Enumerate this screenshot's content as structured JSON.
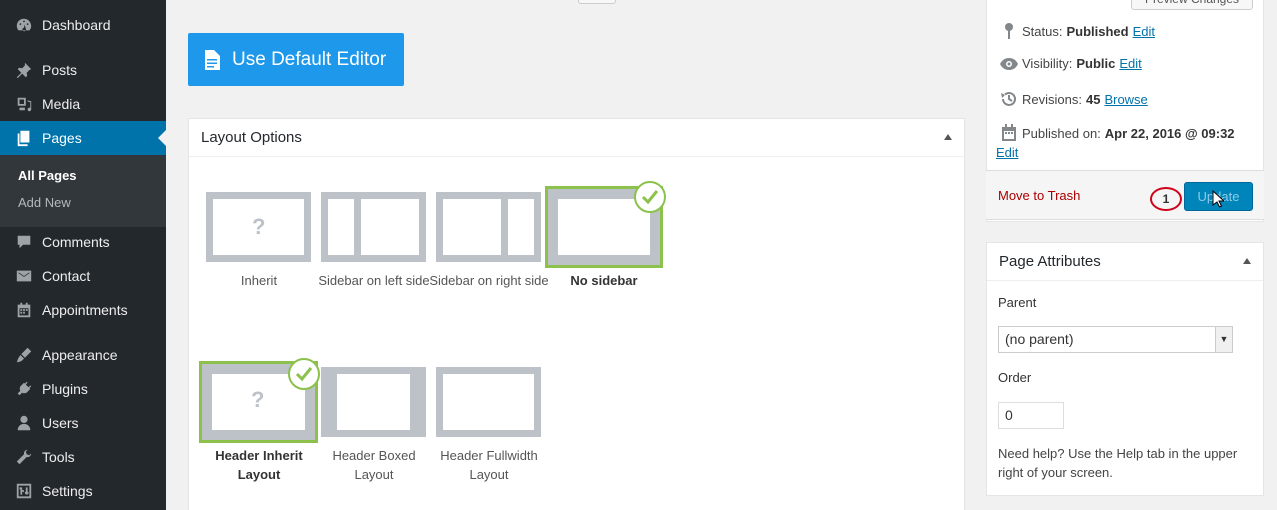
{
  "admin_menu": {
    "items": [
      {
        "label": "Dashboard",
        "icon": "dashboard-icon"
      },
      {
        "label": "Posts",
        "icon": "pin-icon"
      },
      {
        "label": "Media",
        "icon": "media-icon"
      },
      {
        "label": "Pages",
        "icon": "pages-icon",
        "current": true
      },
      {
        "label": "Comments",
        "icon": "comment-icon"
      },
      {
        "label": "Contact",
        "icon": "mail-icon"
      },
      {
        "label": "Appointments",
        "icon": "calendar-icon"
      },
      {
        "label": "Appearance",
        "icon": "brush-icon"
      },
      {
        "label": "Plugins",
        "icon": "plug-icon"
      },
      {
        "label": "Users",
        "icon": "user-icon"
      },
      {
        "label": "Tools",
        "icon": "wrench-icon"
      },
      {
        "label": "Settings",
        "icon": "settings-icon"
      }
    ],
    "submenu": {
      "all_pages": "All Pages",
      "add_new": "Add New"
    }
  },
  "editor": {
    "default_editor_label": "Use Default Editor"
  },
  "layout_options": {
    "title": "Layout Options",
    "sidebar_layouts": [
      {
        "label": "Inherit",
        "selected": false
      },
      {
        "label": "Sidebar on left side",
        "selected": false
      },
      {
        "label": "Sidebar on right side",
        "selected": false
      },
      {
        "label": "No sidebar",
        "selected": true
      }
    ],
    "header_layouts": [
      {
        "label": "Header Inherit Layout",
        "selected": true
      },
      {
        "label": "Header Boxed Layout",
        "selected": false
      },
      {
        "label": "Header Fullwidth Layout",
        "selected": false
      }
    ],
    "inherit_mark": "?"
  },
  "publish": {
    "preview_label": "Preview Changes",
    "status_label": "Status:",
    "status_value": "Published",
    "visibility_label": "Visibility:",
    "visibility_value": "Public",
    "revisions_label": "Revisions:",
    "revisions_value": "45",
    "browse_label": "Browse",
    "published_on_label": "Published on:",
    "published_on_value": "Apr 22, 2016 @ 09:32",
    "edit_label": "Edit",
    "trash_label": "Move to Trash",
    "update_label": "Update",
    "step_marker": "1"
  },
  "page_attributes": {
    "title": "Page Attributes",
    "parent_label": "Parent",
    "parent_value": "(no parent)",
    "order_label": "Order",
    "order_value": "0",
    "help_text": "Need help? Use the Help tab in the upper right of your screen."
  },
  "colors": {
    "sidebar_bg": "#23282d",
    "accent": "#0073aa",
    "editor_button": "#1e98ea",
    "selected_outline": "#8cc14c",
    "thumb_gray": "#bcc2c8",
    "trash": "#a00"
  }
}
